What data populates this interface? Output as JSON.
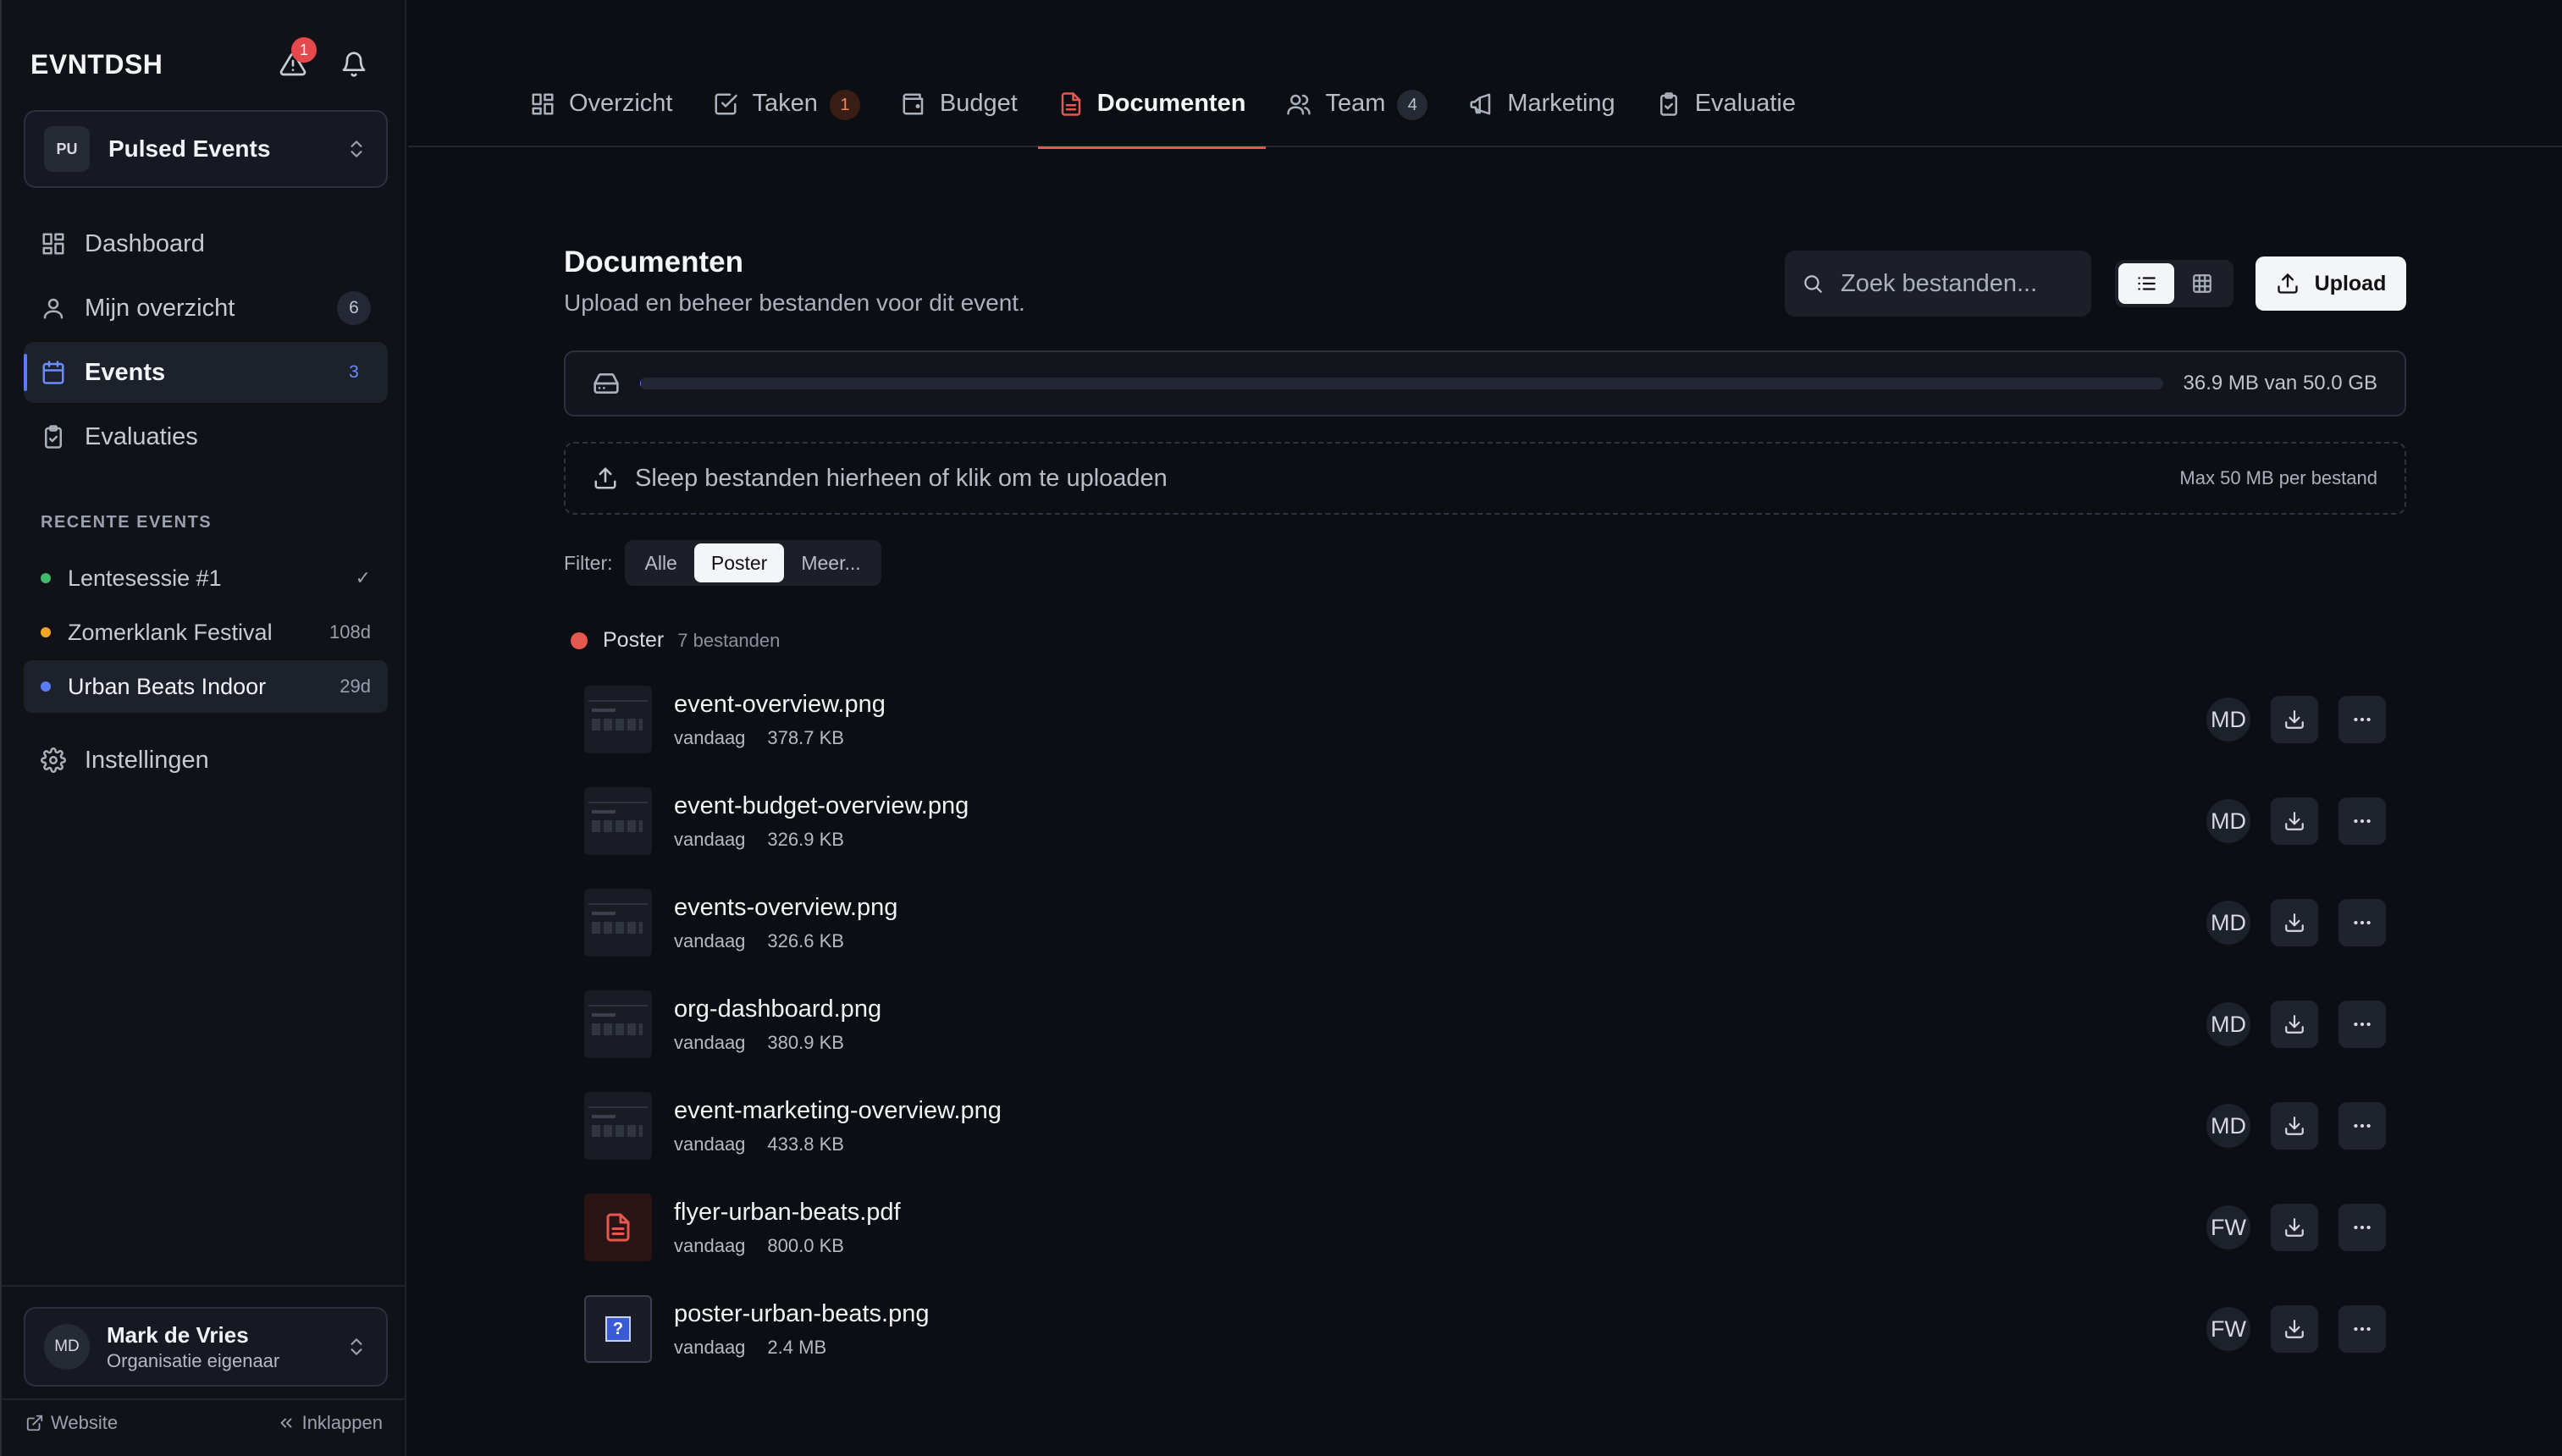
{
  "app": {
    "brand": "EVNTDSH",
    "alert_count": "1"
  },
  "org": {
    "initials": "PU",
    "name": "Pulsed Events"
  },
  "nav": [
    {
      "label": "Dashboard",
      "icon": "dashboard-icon"
    },
    {
      "label": "Mijn overzicht",
      "icon": "user-icon",
      "count": "6"
    },
    {
      "label": "Events",
      "icon": "calendar-icon",
      "count": "3",
      "active": true
    },
    {
      "label": "Evaluaties",
      "icon": "clipboard-check-icon"
    }
  ],
  "recent": {
    "title": "RECENTE EVENTS",
    "items": [
      {
        "name": "Lentesessie #1",
        "meta": "✓",
        "color": "#3fb96a"
      },
      {
        "name": "Zomerklank Festival",
        "meta": "108d",
        "color": "#f5a524"
      },
      {
        "name": "Urban Beats Indoor",
        "meta": "29d",
        "color": "#5b7cfa",
        "active": true
      }
    ]
  },
  "settings": {
    "label": "Instellingen"
  },
  "user": {
    "initials": "MD",
    "name": "Mark de Vries",
    "role": "Organisatie eigenaar"
  },
  "footer": {
    "website": "Website",
    "collapse": "Inklappen"
  },
  "tabs": [
    {
      "label": "Overzicht",
      "icon": "overview-icon"
    },
    {
      "label": "Taken",
      "icon": "checkbox-icon",
      "count": "1",
      "warn": true
    },
    {
      "label": "Budget",
      "icon": "wallet-icon"
    },
    {
      "label": "Documenten",
      "icon": "document-icon",
      "active": true
    },
    {
      "label": "Team",
      "icon": "team-icon",
      "count": "4"
    },
    {
      "label": "Marketing",
      "icon": "megaphone-icon"
    },
    {
      "label": "Evaluatie",
      "icon": "clipboard-check-icon"
    }
  ],
  "documents": {
    "title": "Documenten",
    "subtitle": "Upload en beheer bestanden voor dit event.",
    "search_placeholder": "Zoek bestanden...",
    "upload_label": "Upload",
    "storage": {
      "text": "36.9 MB van 50.0 GB",
      "used_fraction": 0.0007
    },
    "dropzone": {
      "text": "Sleep bestanden hierheen of klik om te uploaden",
      "max": "Max 50 MB per bestand"
    },
    "filter": {
      "label": "Filter:",
      "options": [
        "Alle",
        "Poster",
        "Meer..."
      ],
      "active": "Poster"
    },
    "group": {
      "name": "Poster",
      "count": "7 bestanden",
      "color": "#e5584d"
    },
    "files": [
      {
        "name": "event-overview.png",
        "date": "vandaag",
        "size": "378.7 KB",
        "owner": "MD",
        "thumb": "screenshot"
      },
      {
        "name": "event-budget-overview.png",
        "date": "vandaag",
        "size": "326.9 KB",
        "owner": "MD",
        "thumb": "screenshot"
      },
      {
        "name": "events-overview.png",
        "date": "vandaag",
        "size": "326.6 KB",
        "owner": "MD",
        "thumb": "screenshot"
      },
      {
        "name": "org-dashboard.png",
        "date": "vandaag",
        "size": "380.9 KB",
        "owner": "MD",
        "thumb": "screenshot"
      },
      {
        "name": "event-marketing-overview.png",
        "date": "vandaag",
        "size": "433.8 KB",
        "owner": "MD",
        "thumb": "screenshot"
      },
      {
        "name": "flyer-urban-beats.pdf",
        "date": "vandaag",
        "size": "800.0 KB",
        "owner": "FW",
        "thumb": "pdf"
      },
      {
        "name": "poster-urban-beats.png",
        "date": "vandaag",
        "size": "2.4 MB",
        "owner": "FW",
        "thumb": "poster"
      }
    ]
  }
}
